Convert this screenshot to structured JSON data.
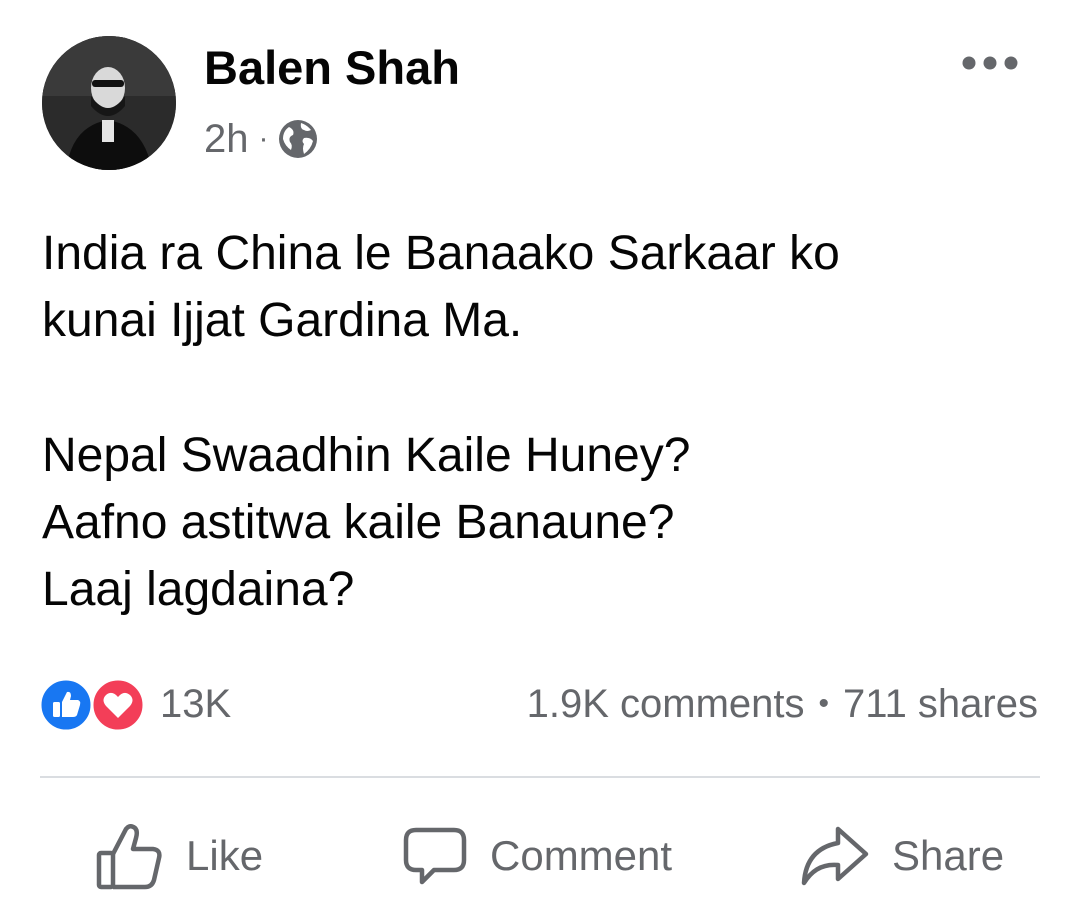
{
  "post": {
    "author": "Balen Shah",
    "time": "2h",
    "separator": "·",
    "privacy_icon": "globe-icon",
    "menu_icon": "more-horizontal-icon",
    "body": {
      "paragraph1": [
        "India ra China le Banaako Sarkaar ko",
        "kunai Ijjat Gardina Ma."
      ],
      "paragraph2": [
        "Nepal Swaadhin Kaile Huney?",
        "Aafno astitwa kaile Banaune?",
        "Laaj lagdaina?"
      ]
    }
  },
  "stats": {
    "reaction_icons": [
      "like-reaction-icon",
      "love-reaction-icon"
    ],
    "reaction_count": "13K",
    "comments": "1.9K comments",
    "dot": "•",
    "shares": "711 shares"
  },
  "actions": {
    "like": "Like",
    "comment": "Comment",
    "share": "Share"
  },
  "colors": {
    "like_blue": "#1877f2",
    "love_red": "#f33e58",
    "secondary_text": "#65676b",
    "primary_text": "#050505",
    "divider": "#dadde1"
  }
}
